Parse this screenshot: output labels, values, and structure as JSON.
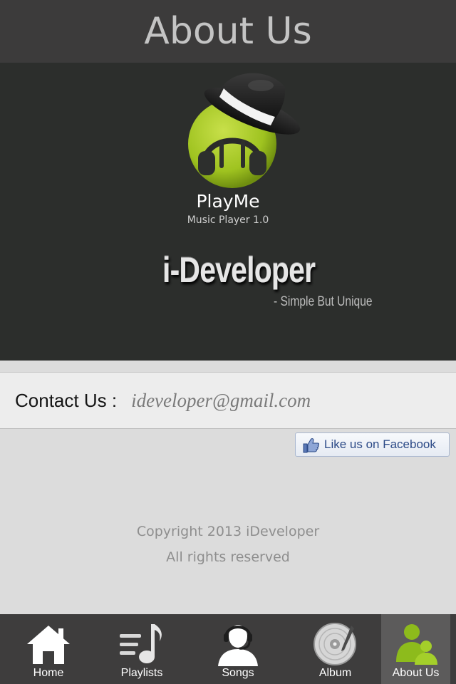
{
  "header": {
    "title": "About Us"
  },
  "banner": {
    "app_name": "PlayMe",
    "app_version": "Music Player 1.0",
    "developer": "i-Developer",
    "tagline": "- Simple But Unique"
  },
  "contact": {
    "label": "Contact Us :",
    "email": "ideveloper@gmail.com"
  },
  "facebook": {
    "label": "Like us on Facebook"
  },
  "footer": {
    "copyright_line1": "Copyright 2013 iDeveloper",
    "copyright_line2": "All rights reserved"
  },
  "tabs": [
    {
      "label": "Home",
      "icon": "home-icon",
      "active": false
    },
    {
      "label": "Playlists",
      "icon": "playlist-icon",
      "active": false
    },
    {
      "label": "Songs",
      "icon": "headset-user-icon",
      "active": false
    },
    {
      "label": "Album",
      "icon": "vinyl-disc-icon",
      "active": false
    },
    {
      "label": "About Us",
      "icon": "users-icon",
      "active": true
    }
  ],
  "colors": {
    "header_bg": "#3c3b3b",
    "banner_bg": "#2c2e2c",
    "logo_green": "#9fc320",
    "tab_active_green": "#8dbb1c",
    "facebook_blue": "#2c4a87"
  }
}
